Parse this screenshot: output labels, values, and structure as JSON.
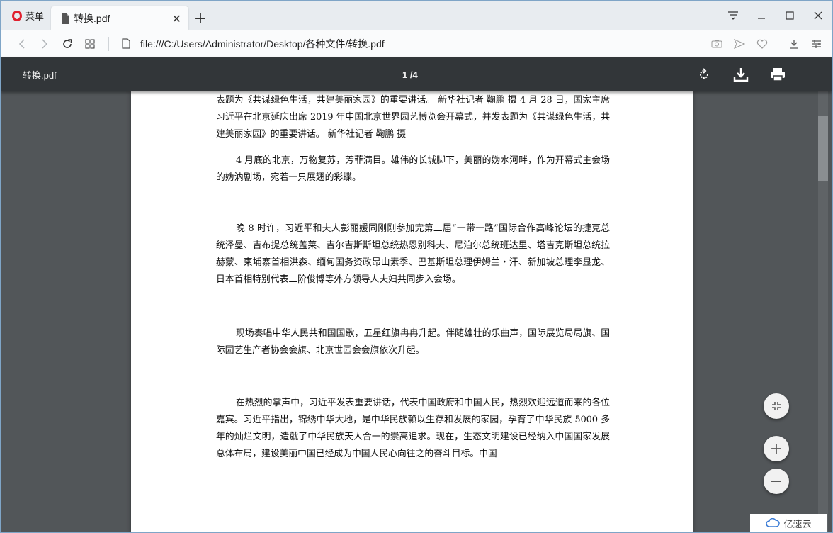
{
  "browser": {
    "menu_label": "菜单",
    "tab": {
      "title": "转换.pdf",
      "close_symbol": "✕"
    },
    "new_tab_symbol": "+",
    "url": "file:///C:/Users/Administrator/Desktop/各种文件/转换.pdf"
  },
  "pdf_toolbar": {
    "file_name": "转换.pdf",
    "page_indicator": "1 /4"
  },
  "document": {
    "paragraphs": [
      "表题为《共谋绿色生活，共建美丽家园》的重要讲话。 新华社记者 鞠鹏 摄 4 月 28 日，国家主席习近平在北京延庆出席 2019 年中国北京世界园艺博览会开幕式，并发表题为《共谋绿色生活，共建美丽家园》的重要讲话。 新华社记者 鞠鹏 摄",
      "4 月底的北京，万物复苏，芳菲满目。雄伟的长城脚下，美丽的妫水河畔，作为开幕式主会场的妫汭剧场，宛若一只展翅的彩蝶。",
      "晚 8 时许，习近平和夫人彭丽媛同刚刚参加完第二届“一带一路”国际合作高峰论坛的捷克总统泽曼、吉布提总统盖莱、吉尔吉斯斯坦总统热恩别科夫、尼泊尔总统班达里、塔吉克斯坦总统拉赫蒙、柬埔寨首相洪森、缅甸国务资政昂山素季、巴基斯坦总理伊姆兰・汗、新加坡总理李显龙、日本首相特别代表二阶俊博等外方领导人夫妇共同步入会场。",
      "现场奏唱中华人民共和国国歌，五星红旗冉冉升起。伴随雄壮的乐曲声，国际展览局局旗、国际园艺生产者协会会旗、北京世园会会旗依次升起。",
      "在热烈的掌声中，习近平发表重要讲话，代表中国政府和中国人民，热烈欢迎远道而来的各位嘉宾。习近平指出，锦绣中华大地，是中华民族赖以生存和发展的家园，孕育了中华民族 5000 多年的灿烂文明，造就了中华民族天人合一的崇高追求。现在，生态文明建设已经纳入中国国家发展总体布局，建设美丽中国已经成为中国人民心向往之的奋斗目标。中国"
    ]
  },
  "zoom_controls": {
    "zoom_in": "+",
    "zoom_out": "−"
  },
  "watermark": {
    "text": "亿速云"
  },
  "icons": {
    "rotate": "rotate-icon",
    "download": "download-icon",
    "print": "print-icon",
    "fit": "fit-to-page-icon"
  }
}
